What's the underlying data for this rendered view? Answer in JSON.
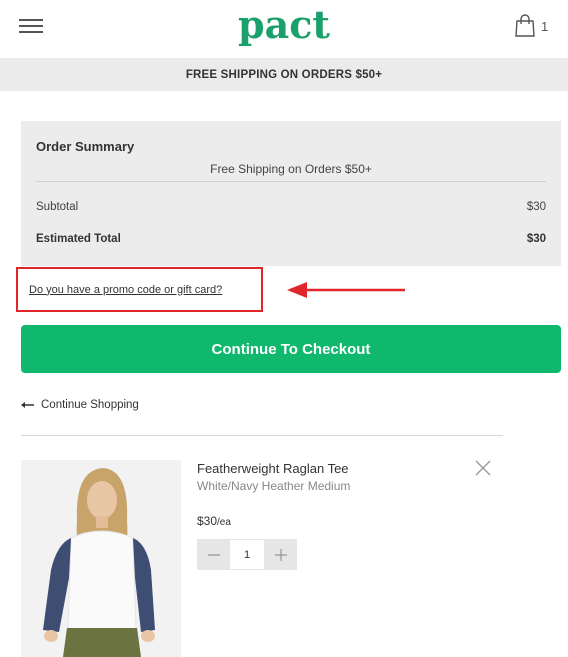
{
  "header": {
    "logo": "pact",
    "cart_count": "1"
  },
  "banner": {
    "text": "FREE SHIPPING ON ORDERS $50+"
  },
  "order_summary": {
    "title": "Order Summary",
    "shipping_note": "Free Shipping on Orders $50+",
    "subtotal_label": "Subtotal",
    "subtotal_value": "$30",
    "total_label": "Estimated Total",
    "total_value": "$30"
  },
  "promo": {
    "link_text": "Do you have a promo code or gift card?",
    "highlight_color": "#e0262b"
  },
  "checkout": {
    "button_label": "Continue To Checkout",
    "color": "#10b86d"
  },
  "continue_shopping": {
    "label": "Continue Shopping"
  },
  "cart_item": {
    "name": "Featherweight Raglan Tee",
    "variant": "White/Navy Heather Medium",
    "price": "$30",
    "price_unit": "/ea",
    "quantity": "1"
  }
}
